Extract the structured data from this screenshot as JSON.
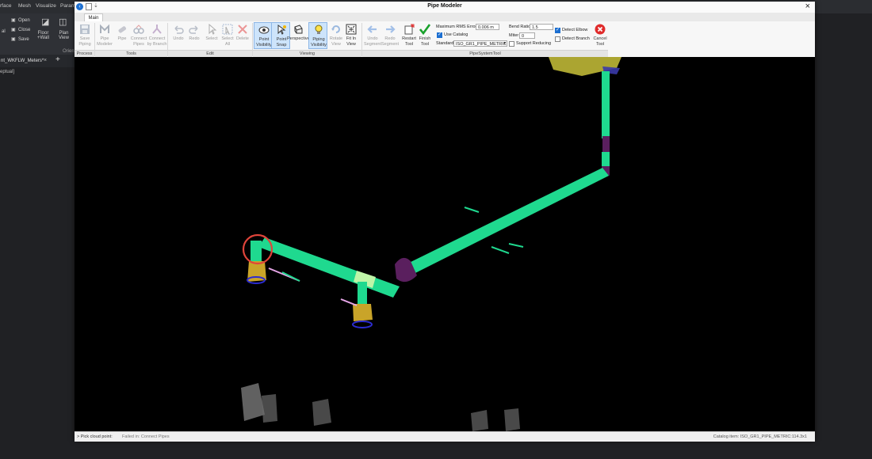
{
  "host": {
    "menu": [
      "rface",
      "Mesh",
      "Visualize",
      "Param"
    ],
    "file_buttons": [
      "Open",
      "Close",
      "Save"
    ],
    "ribbon_buttons": [
      "Floor\n+Wall",
      "Plan\nView"
    ],
    "orient_label": "Orien",
    "doc_tab": "nt_WKFLW_Meters*",
    "view_label": "eptual]"
  },
  "window": {
    "title": "Pipe Modeler",
    "tab": "Main",
    "ribbon": {
      "process": {
        "label": "Process",
        "buttons": [
          {
            "label": "Save\nPiping",
            "enabled": false
          }
        ]
      },
      "tools": {
        "label": "Tools",
        "buttons": [
          {
            "label": "Pipe\nModeler",
            "enabled": false
          },
          {
            "label": "Pipe",
            "enabled": false
          },
          {
            "label": "Connect\nPipes",
            "enabled": false
          },
          {
            "label": "Connect\nby Branch",
            "enabled": false
          }
        ]
      },
      "edit": {
        "label": "Edit",
        "buttons": [
          {
            "label": "Undo",
            "enabled": false
          },
          {
            "label": "Redo",
            "enabled": false
          },
          {
            "label": "Select",
            "enabled": false
          },
          {
            "label": "Select\nAll",
            "enabled": false
          },
          {
            "label": "Delete",
            "enabled": false
          }
        ]
      },
      "viewing": {
        "label": "Viewing",
        "buttons": [
          {
            "label": "Point\nVisibility",
            "enabled": true,
            "active": true
          },
          {
            "label": "Point\nSnap",
            "enabled": true,
            "active": true
          },
          {
            "label": "Perspective",
            "enabled": true
          },
          {
            "label": "Piping\nVisibility",
            "enabled": true,
            "active": true
          },
          {
            "label": "Rotate\nView",
            "enabled": false
          },
          {
            "label": "Fit In\nView",
            "enabled": true
          }
        ]
      },
      "pipesystem": {
        "label": "PipeSystemTool",
        "buttons": [
          {
            "label": "Undo\nSegment",
            "enabled": false
          },
          {
            "label": "Redo\nSegment",
            "enabled": false
          },
          {
            "label": "Restart\nTool",
            "enabled": true
          },
          {
            "label": "Finish\nTool",
            "enabled": true
          }
        ]
      },
      "params": {
        "max_rms_label": "Maximum RMS Error",
        "max_rms_value": "0.006 m",
        "use_catalog_label": "Use Catalog",
        "use_catalog_checked": true,
        "standard_label": "Standard",
        "standard_value": "ISO_GR1_PIPE_METRIC",
        "bend_ratio_label": "Bend Ratio",
        "bend_ratio_value": "1.5",
        "miter_label": "Miter",
        "miter_value": "0",
        "support_reducing_label": "Support Reducing",
        "support_reducing_checked": false,
        "detect_elbow_label": "Detect Elbow",
        "detect_elbow_checked": true,
        "detect_branch_label": "Detect Branch",
        "detect_branch_checked": false,
        "cancel_label": "Cancel\nTool"
      }
    },
    "status": {
      "prompt": "> Pick cloud point:",
      "message": "Failed in: Connect Pipes",
      "catalog": "Catalog item: ISO_GR1_PIPE_METRIC:114.3x1"
    },
    "colors": {
      "pipe": "#1fd98f",
      "elbow": "#5a1f5e",
      "tee": "#bff5a8",
      "highlight_ring": "#e0443a",
      "support": "#d9c23a"
    }
  }
}
